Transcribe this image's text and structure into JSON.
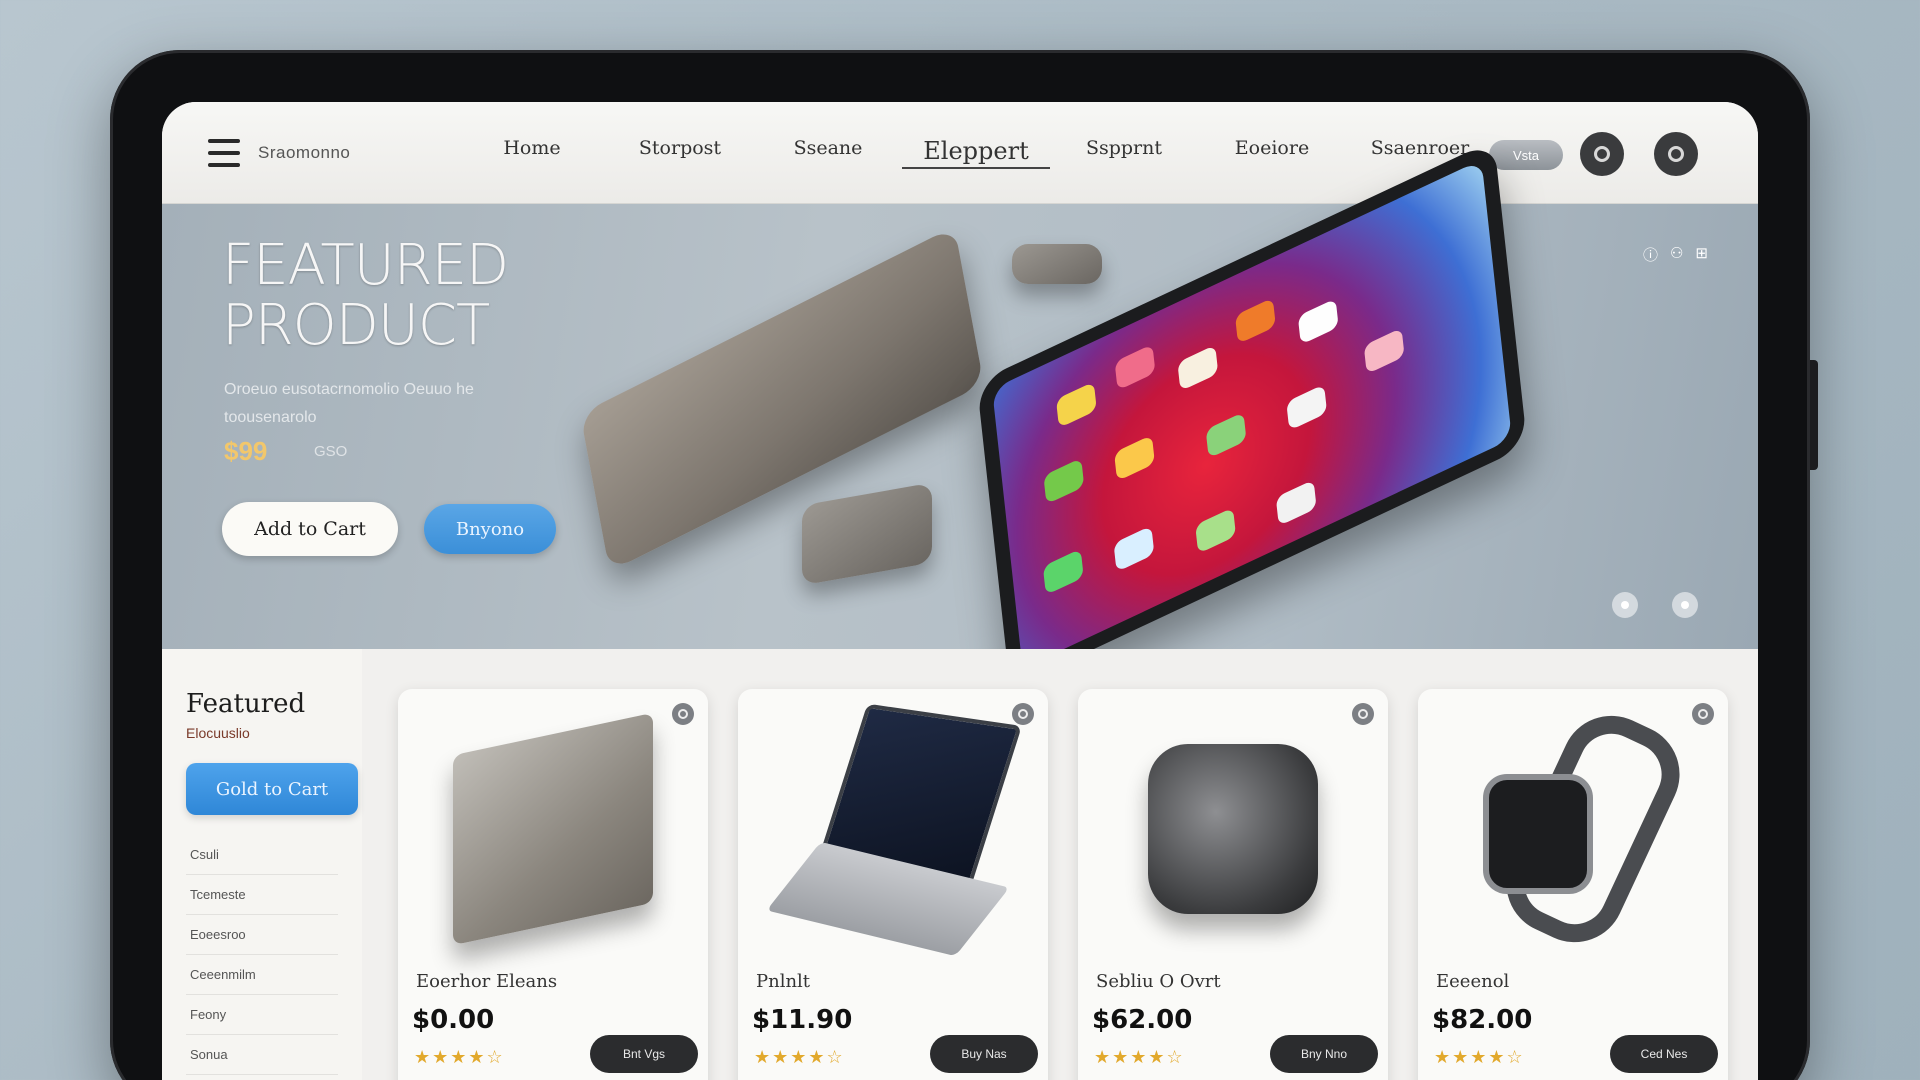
{
  "nav": {
    "brand": "Sraomonno",
    "links": [
      "Home",
      "Storpost",
      "Sseane",
      "Eleppert",
      "Sspprnt",
      "Eoeiore",
      "Ssaenroer"
    ],
    "active_index": 3,
    "pill_label": "Vsta"
  },
  "hero": {
    "title_line1": "FEATURED",
    "title_line2": "PRODUCT",
    "description": "Oroeuo eusotacrnomolio Oeuuo he toousenarolo",
    "price": "$99",
    "old_price": "GSO",
    "add_to_cart_label": "Add to Cart",
    "buy_label": "Bnyono",
    "icons": [
      "info-icon",
      "share-icon",
      "grid-icon"
    ],
    "slide_count": 2
  },
  "sidebar": {
    "title": "Featured",
    "subtitle": "Elocuuslio",
    "add_to_cart_label": "Gold to Cart",
    "items": [
      "Csuli",
      "Tcemeste",
      "Eoeesroo",
      "Ceeenmilm",
      "Feony",
      "Sonua"
    ]
  },
  "products": [
    {
      "name": "Eoerhor Eleans",
      "price": "$0.00",
      "rating": 4,
      "button": "Bnt Vgs"
    },
    {
      "name": "Pnlnlt",
      "price": "$11.90",
      "rating": 4,
      "button": "Buy Nas"
    },
    {
      "name": "Sebliu O Ovrt",
      "price": "$62.00",
      "rating": 4,
      "button": "Bny Nno"
    },
    {
      "name": "Eeeenol",
      "price": "$82.00",
      "rating": 4,
      "button": "Ced Nes"
    }
  ],
  "colors": {
    "accent_blue": "#3b8fd8",
    "dark_button": "#2b2c2e",
    "star": "#e2a92c"
  }
}
